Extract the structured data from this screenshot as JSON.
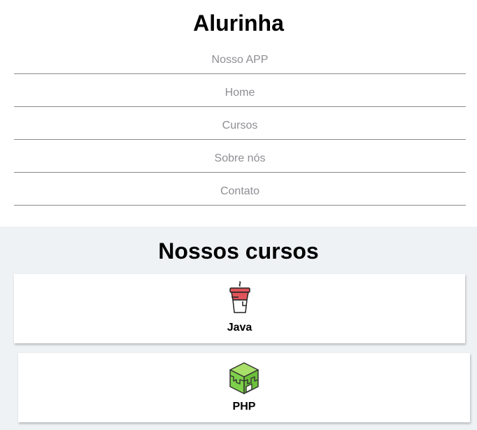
{
  "header": {
    "brand": "Alurinha",
    "nav": [
      "Nosso APP",
      "Home",
      "Cursos",
      "Sobre nós",
      "Contato"
    ]
  },
  "courses": {
    "title": "Nossos cursos",
    "items": [
      {
        "name": "Java",
        "icon": "java-cup-icon"
      },
      {
        "name": "PHP",
        "icon": "php-cube-icon"
      }
    ]
  },
  "colors": {
    "nav_text": "#8e8e94",
    "section_bg": "#eff2f5",
    "java_red": "#e0555a",
    "php_green": "#7ed14a"
  }
}
